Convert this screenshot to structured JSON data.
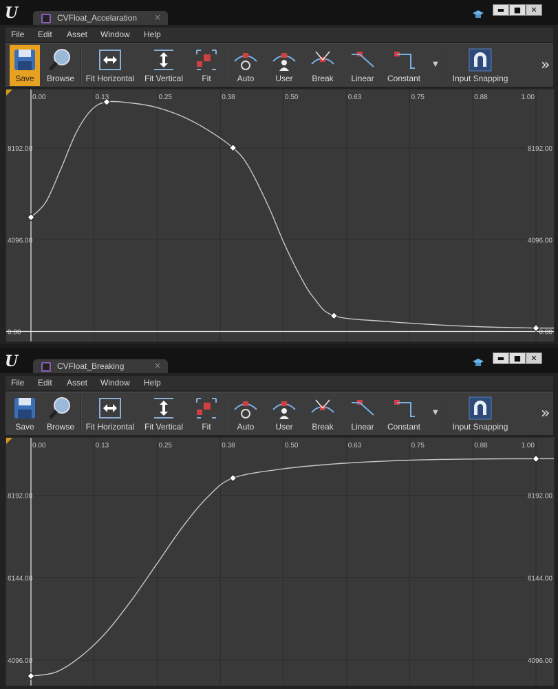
{
  "windows": [
    {
      "tab_title": "CVFloat_Accelaration",
      "tab_close": "×",
      "window_buttons": {
        "minimize": "▬",
        "maximize": "■",
        "close": "✕"
      },
      "menu": [
        "File",
        "Edit",
        "Asset",
        "Window",
        "Help"
      ],
      "toolbar": {
        "save": "Save",
        "browse": "Browse",
        "fit_horizontal": "Fit Horizontal",
        "fit_vertical": "Fit Vertical",
        "fit": "Fit",
        "auto": "Auto",
        "user": "User",
        "break": "Break",
        "linear": "Linear",
        "constant": "Constant",
        "input_snapping": "Input Snapping",
        "save_active": true
      },
      "chart_data": {
        "type": "line",
        "x_ticks": [
          "0.00",
          "0.13",
          "0.25",
          "0.38",
          "0.50",
          "0.63",
          "0.75",
          "0.88",
          "1.00"
        ],
        "y_ticks": [
          {
            "value": 8192,
            "label": "8192.00"
          },
          {
            "value": 4096,
            "label": "4096.00"
          },
          {
            "value": 0,
            "label": "0.00"
          }
        ],
        "ylim": [
          -200,
          10500
        ],
        "xlim": [
          -0.05,
          1.0
        ],
        "keys": [
          {
            "x": 0.0,
            "y": 5100
          },
          {
            "x": 0.15,
            "y": 10250
          },
          {
            "x": 0.4,
            "y": 8200
          },
          {
            "x": 0.6,
            "y": 700
          },
          {
            "x": 1.0,
            "y": 150
          }
        ],
        "curve": [
          [
            0.0,
            5100
          ],
          [
            0.03,
            5800
          ],
          [
            0.06,
            7300
          ],
          [
            0.09,
            8900
          ],
          [
            0.12,
            9900
          ],
          [
            0.15,
            10250
          ],
          [
            0.2,
            10200
          ],
          [
            0.25,
            10000
          ],
          [
            0.3,
            9600
          ],
          [
            0.35,
            9000
          ],
          [
            0.4,
            8200
          ],
          [
            0.43,
            7400
          ],
          [
            0.47,
            5600
          ],
          [
            0.5,
            4000
          ],
          [
            0.53,
            2600
          ],
          [
            0.56,
            1500
          ],
          [
            0.6,
            700
          ],
          [
            0.7,
            450
          ],
          [
            0.8,
            300
          ],
          [
            0.9,
            200
          ],
          [
            1.0,
            150
          ]
        ]
      }
    },
    {
      "tab_title": "CVFloat_Breaking",
      "tab_close": "×",
      "window_buttons": {
        "minimize": "▬",
        "maximize": "■",
        "close": "✕"
      },
      "menu": [
        "File",
        "Edit",
        "Asset",
        "Window",
        "Help"
      ],
      "toolbar": {
        "save": "Save",
        "browse": "Browse",
        "fit_horizontal": "Fit Horizontal",
        "fit_vertical": "Fit Vertical",
        "fit": "Fit",
        "auto": "Auto",
        "user": "User",
        "break": "Break",
        "linear": "Linear",
        "constant": "Constant",
        "input_snapping": "Input Snapping",
        "save_active": false
      },
      "chart_data": {
        "type": "line",
        "x_ticks": [
          "0.00",
          "0.13",
          "0.25",
          "0.38",
          "0.50",
          "0.63",
          "0.75",
          "0.88",
          "1.00"
        ],
        "y_ticks": [
          {
            "value": 8192,
            "label": "8192.00"
          },
          {
            "value": 6144,
            "label": "6144.00"
          },
          {
            "value": 4096,
            "label": "4096.00"
          }
        ],
        "ylim": [
          3600,
          9450
        ],
        "xlim": [
          -0.05,
          1.0
        ],
        "keys": [
          {
            "x": 0.0,
            "y": 3700
          },
          {
            "x": 0.4,
            "y": 8620
          },
          {
            "x": 1.0,
            "y": 9100
          }
        ],
        "curve": [
          [
            0.0,
            3700
          ],
          [
            0.05,
            3800
          ],
          [
            0.1,
            4200
          ],
          [
            0.15,
            4800
          ],
          [
            0.2,
            5600
          ],
          [
            0.25,
            6500
          ],
          [
            0.3,
            7400
          ],
          [
            0.35,
            8150
          ],
          [
            0.4,
            8620
          ],
          [
            0.5,
            8850
          ],
          [
            0.6,
            8970
          ],
          [
            0.7,
            9040
          ],
          [
            0.8,
            9080
          ],
          [
            0.9,
            9095
          ],
          [
            1.0,
            9100
          ]
        ]
      }
    }
  ]
}
